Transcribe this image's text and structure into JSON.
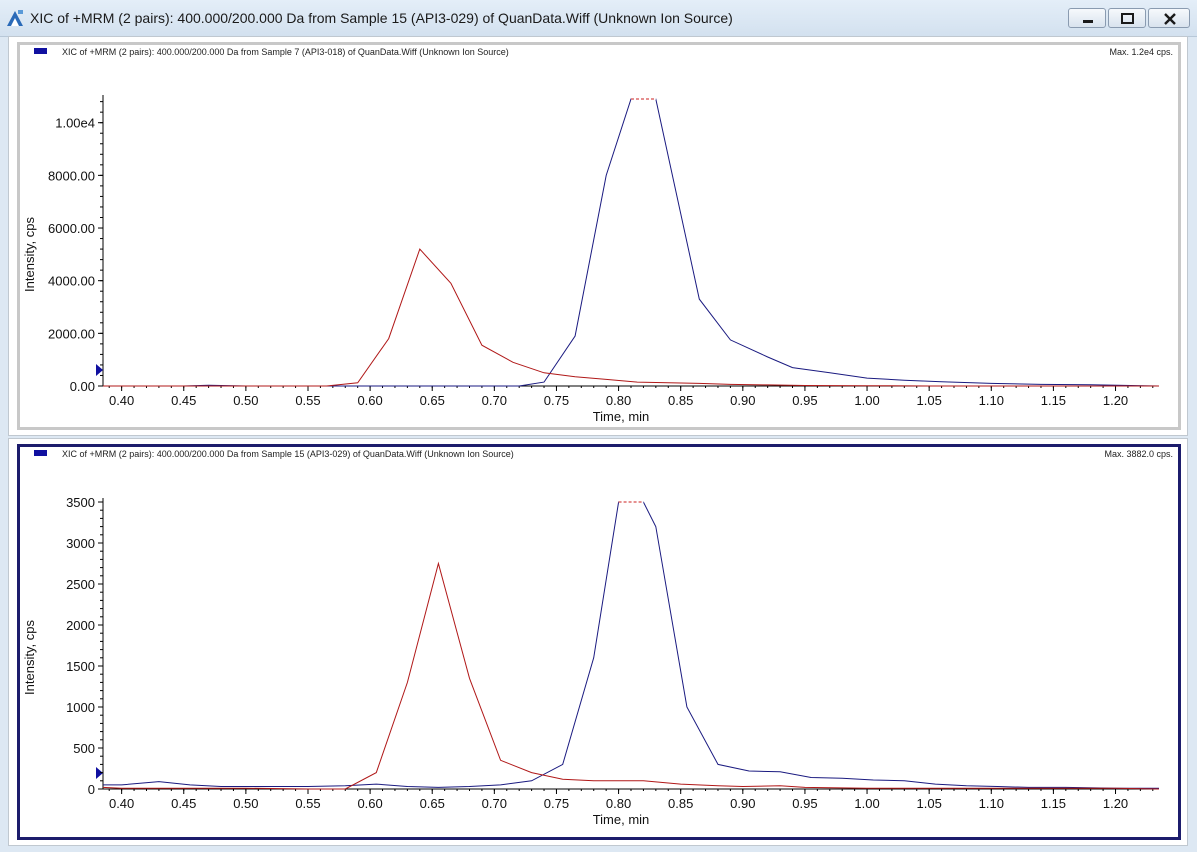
{
  "window": {
    "title": "XIC of +MRM (2 pairs): 400.000/200.000 Da  from Sample 15 (API3-029) of QuanData.Wiff (Unknown Ion Source)"
  },
  "colors": {
    "series_blue": "#1a1a80",
    "series_red": "#b01818",
    "frame_active": "#1c1c6c"
  },
  "icons": {
    "app": "analyst-app-icon",
    "minimize": "minimize-icon",
    "maximize": "maximize-icon",
    "close": "close-icon"
  },
  "chart_data": [
    {
      "type": "line",
      "header": "XIC of +MRM (2 pairs): 400.000/200.000 Da  from Sample 7 (API3-018) of QuanData.Wiff (Unknown Ion Source)",
      "max_label": "Max. 1.2e4 cps.",
      "xlabel": "Time, min",
      "ylabel": "Intensity, cps",
      "xlim": [
        0.385,
        1.235
      ],
      "ylim": [
        0,
        10900
      ],
      "x_ticks": [
        "0.40",
        "0.45",
        "0.50",
        "0.55",
        "0.60",
        "0.65",
        "0.70",
        "0.75",
        "0.80",
        "0.85",
        "0.90",
        "0.95",
        "1.00",
        "1.05",
        "1.10",
        "1.15",
        "1.20"
      ],
      "y_ticks": [
        {
          "value": 0,
          "label": "0.00"
        },
        {
          "value": 2000,
          "label": "2000.00"
        },
        {
          "value": 4000,
          "label": "4000.00"
        },
        {
          "value": 6000,
          "label": "6000.00"
        },
        {
          "value": 8000,
          "label": "8000.00"
        },
        {
          "value": 10000,
          "label": "1.00e4"
        }
      ],
      "clip_level": 10900,
      "series": [
        {
          "color": "#1a1a80",
          "x": [
            0.385,
            0.4,
            0.45,
            0.47,
            0.5,
            0.55,
            0.6,
            0.65,
            0.7,
            0.72,
            0.74,
            0.765,
            0.79,
            0.81,
            0.83,
            0.865,
            0.89,
            0.92,
            0.94,
            0.97,
            1.0,
            1.03,
            1.06,
            1.1,
            1.14,
            1.18,
            1.235
          ],
          "y": [
            0,
            0,
            0,
            30,
            0,
            0,
            0,
            0,
            0,
            0,
            150,
            1900,
            8000,
            11800,
            11800,
            3300,
            1750,
            1100,
            700,
            500,
            300,
            220,
            160,
            100,
            60,
            50,
            0
          ]
        },
        {
          "color": "#b01818",
          "x": [
            0.385,
            0.5,
            0.565,
            0.59,
            0.615,
            0.64,
            0.665,
            0.69,
            0.715,
            0.74,
            0.765,
            0.79,
            0.815,
            0.84,
            0.865,
            0.89,
            0.92,
            0.95,
            1.0,
            1.05,
            1.235
          ],
          "y": [
            0,
            0,
            0,
            120,
            1800,
            5200,
            3900,
            1550,
            900,
            500,
            350,
            250,
            150,
            120,
            100,
            60,
            40,
            20,
            10,
            0,
            0
          ]
        }
      ]
    },
    {
      "type": "line",
      "header": "XIC of +MRM (2 pairs): 400.000/200.000 Da  from Sample 15 (API3-029) of QuanData.Wiff (Unknown Ion Source)",
      "max_label": "Max. 3882.0 cps.",
      "xlabel": "Time, min",
      "ylabel": "Intensity, cps",
      "xlim": [
        0.385,
        1.235
      ],
      "ylim": [
        0,
        3500
      ],
      "x_ticks": [
        "0.40",
        "0.45",
        "0.50",
        "0.55",
        "0.60",
        "0.65",
        "0.70",
        "0.75",
        "0.80",
        "0.85",
        "0.90",
        "0.95",
        "1.00",
        "1.05",
        "1.10",
        "1.15",
        "1.20"
      ],
      "y_ticks": [
        {
          "value": 0,
          "label": "0"
        },
        {
          "value": 500,
          "label": "500"
        },
        {
          "value": 1000,
          "label": "1000"
        },
        {
          "value": 1500,
          "label": "1500"
        },
        {
          "value": 2000,
          "label": "2000"
        },
        {
          "value": 2500,
          "label": "2500"
        },
        {
          "value": 3000,
          "label": "3000"
        },
        {
          "value": 3500,
          "label": "3500"
        }
      ],
      "clip_level": 3500,
      "series": [
        {
          "color": "#1a1a80",
          "x": [
            0.385,
            0.4,
            0.43,
            0.455,
            0.48,
            0.5,
            0.55,
            0.58,
            0.605,
            0.63,
            0.655,
            0.68,
            0.705,
            0.73,
            0.755,
            0.78,
            0.8,
            0.82,
            0.83,
            0.855,
            0.88,
            0.905,
            0.93,
            0.955,
            0.98,
            1.005,
            1.03,
            1.055,
            1.08,
            1.105,
            1.13,
            1.16,
            1.2,
            1.235
          ],
          "y": [
            50,
            50,
            90,
            50,
            30,
            30,
            30,
            40,
            60,
            30,
            20,
            30,
            50,
            100,
            300,
            1600,
            3880,
            3880,
            3200,
            1000,
            300,
            220,
            210,
            140,
            130,
            110,
            100,
            60,
            40,
            30,
            20,
            20,
            10,
            10
          ]
        },
        {
          "color": "#b01818",
          "x": [
            0.385,
            0.4,
            0.45,
            0.5,
            0.55,
            0.58,
            0.605,
            0.63,
            0.655,
            0.68,
            0.705,
            0.73,
            0.755,
            0.78,
            0.8,
            0.82,
            0.85,
            0.88,
            0.9,
            0.93,
            0.95,
            1.0,
            1.05,
            1.1,
            1.15,
            1.2,
            1.235
          ],
          "y": [
            20,
            10,
            10,
            10,
            0,
            0,
            200,
            1300,
            2750,
            1350,
            350,
            200,
            120,
            100,
            100,
            100,
            60,
            40,
            30,
            40,
            20,
            10,
            10,
            10,
            10,
            10,
            0
          ]
        }
      ]
    }
  ]
}
